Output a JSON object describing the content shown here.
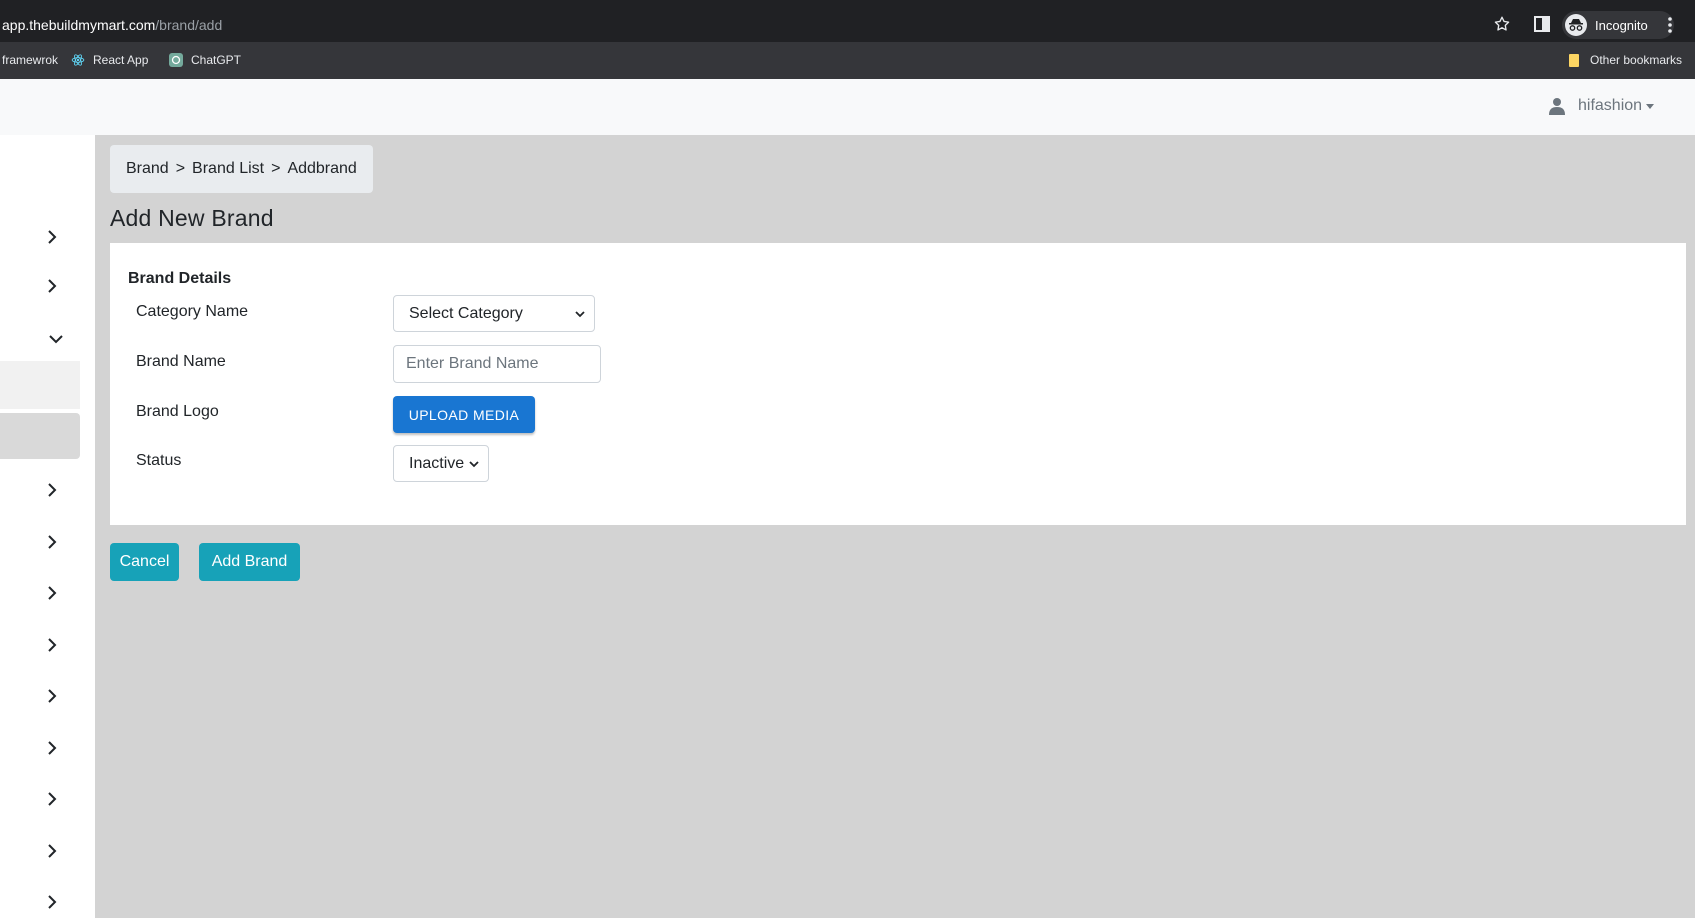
{
  "browser": {
    "url_host": "app.thebuildmymart.com",
    "url_path": "/brand/add",
    "profile_label": "Incognito",
    "bookmarks": [
      {
        "label": "framewrok",
        "icon": "none"
      },
      {
        "label": "React App",
        "icon": "react-icon"
      },
      {
        "label": "ChatGPT",
        "icon": "chatgpt-icon"
      }
    ],
    "other_bookmarks": "Other bookmarks"
  },
  "header": {
    "username": "hifashion"
  },
  "breadcrumb": {
    "items": [
      "Brand",
      "Brand List",
      "Addbrand"
    ],
    "separator": ">"
  },
  "page": {
    "title": "Add New Brand"
  },
  "form": {
    "section_title": "Brand Details",
    "category_label": "Category Name",
    "category_value": "Select Category",
    "brand_name_label": "Brand Name",
    "brand_name_placeholder": "Enter Brand Name",
    "brand_logo_label": "Brand Logo",
    "upload_label": "UPLOAD MEDIA",
    "status_label": "Status",
    "status_value": "Inactive"
  },
  "actions": {
    "cancel_label": "Cancel",
    "submit_label": "Add Brand"
  },
  "colors": {
    "primary_upload": "#1976d2",
    "action_button": "#17a2b8",
    "content_background": "#d3d3d3"
  }
}
